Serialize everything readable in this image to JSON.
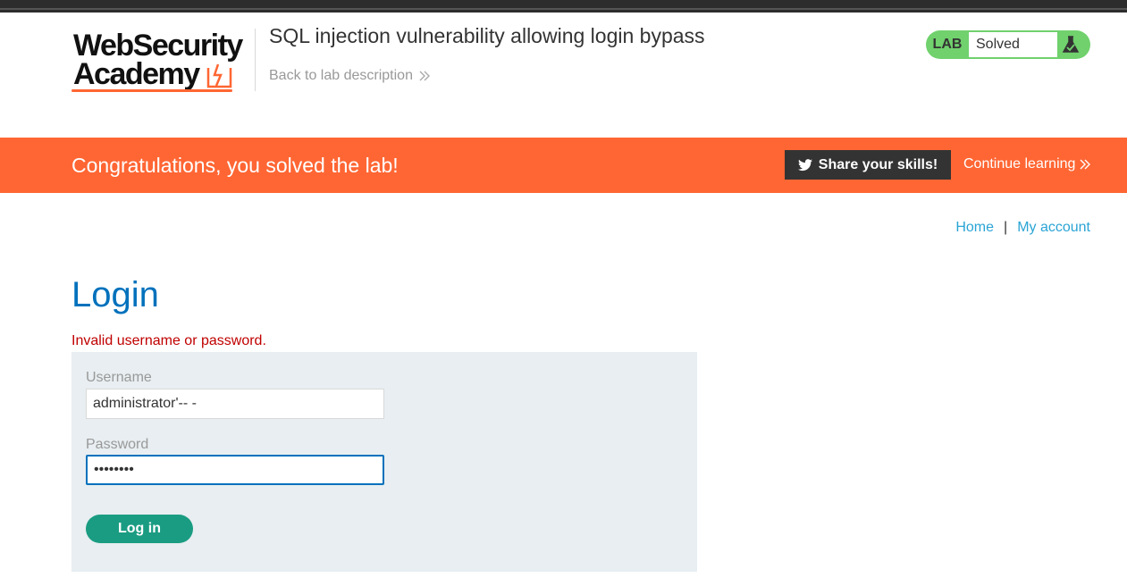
{
  "header": {
    "logo": {
      "line1": "WebSecurity",
      "line2": "Academy"
    },
    "lab_title": "SQL injection vulnerability allowing login bypass",
    "back_link": "Back to lab description",
    "lab_badge": {
      "label": "LAB",
      "status": "Solved",
      "icon": "flask-icon"
    }
  },
  "banner": {
    "message": "Congratulations, you solved the lab!",
    "share_button": "Share your skills!",
    "continue_link": "Continue learning"
  },
  "nav": {
    "home": "Home",
    "separator": "|",
    "account": "My account"
  },
  "main": {
    "title": "Login",
    "error": "Invalid username or password.",
    "form": {
      "username_label": "Username",
      "username_value": "administrator'-- -",
      "password_label": "Password",
      "password_value": "••••••••",
      "submit_label": "Log in"
    }
  },
  "colors": {
    "accent_orange": "#ff6633",
    "lab_green": "#70d16d",
    "title_blue": "#0071bc",
    "link_blue": "#2aa4d5",
    "button_teal": "#1a9c82",
    "error_red": "#c00000"
  }
}
